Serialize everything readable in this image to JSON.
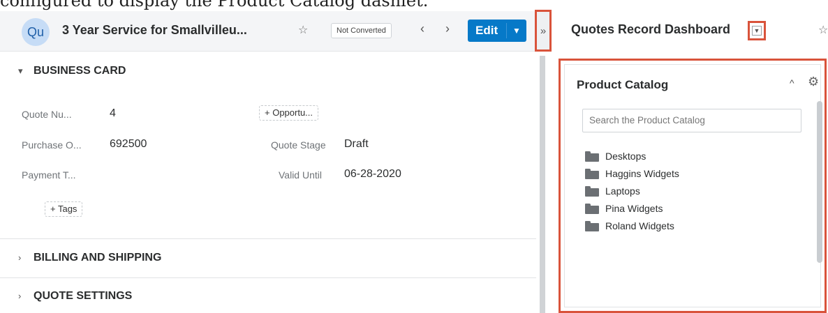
{
  "caption": "configured to display the Product Catalog dashlet.",
  "record": {
    "avatar_initials": "Qu",
    "title": "3 Year Service for Smallvilleu...",
    "status": "Not Converted",
    "nav_prev": "‹",
    "nav_next": "›",
    "edit_label": "Edit",
    "edit_caret": "⌄"
  },
  "sections": {
    "business_card": "BUSINESS CARD",
    "billing": "BILLING AND SHIPPING",
    "quote_settings": "QUOTE SETTINGS"
  },
  "fields": {
    "quote_number_label": "Quote Nu...",
    "quote_number_value": "4",
    "purchase_order_label": "Purchase O...",
    "purchase_order_value": "692500",
    "payment_terms_label": "Payment T...",
    "opportunity_button": "+ Opportu...",
    "quote_stage_label": "Quote Stage",
    "quote_stage_value": "Draft",
    "valid_until_label": "Valid Until",
    "valid_until_value": "06-28-2020",
    "tags_button": "+ Tags"
  },
  "splitter": {
    "toggle_glyph": "»"
  },
  "dashboard": {
    "title": "Quotes Record Dashboard",
    "dropdown_glyph": "⌄",
    "dashlet": {
      "title": "Product Catalog",
      "collapse_glyph": "^",
      "search_placeholder": "Search the Product Catalog",
      "folders": [
        "Desktops",
        "Haggins Widgets",
        "Laptops",
        "Pina Widgets",
        "Roland Widgets"
      ]
    }
  },
  "colors": {
    "accent": "#0679c8",
    "highlight_box": "#d9533b",
    "avatar_bg": "#c6dcf6",
    "header_bg": "#f4f5f7"
  },
  "icons": [
    "star-icon",
    "chevron-left-icon",
    "chevron-right-icon",
    "chevron-down-icon",
    "chevron-right-icon",
    "collapse-sidebar-icon",
    "folder-icon",
    "gear-icon",
    "chevron-up-icon"
  ]
}
